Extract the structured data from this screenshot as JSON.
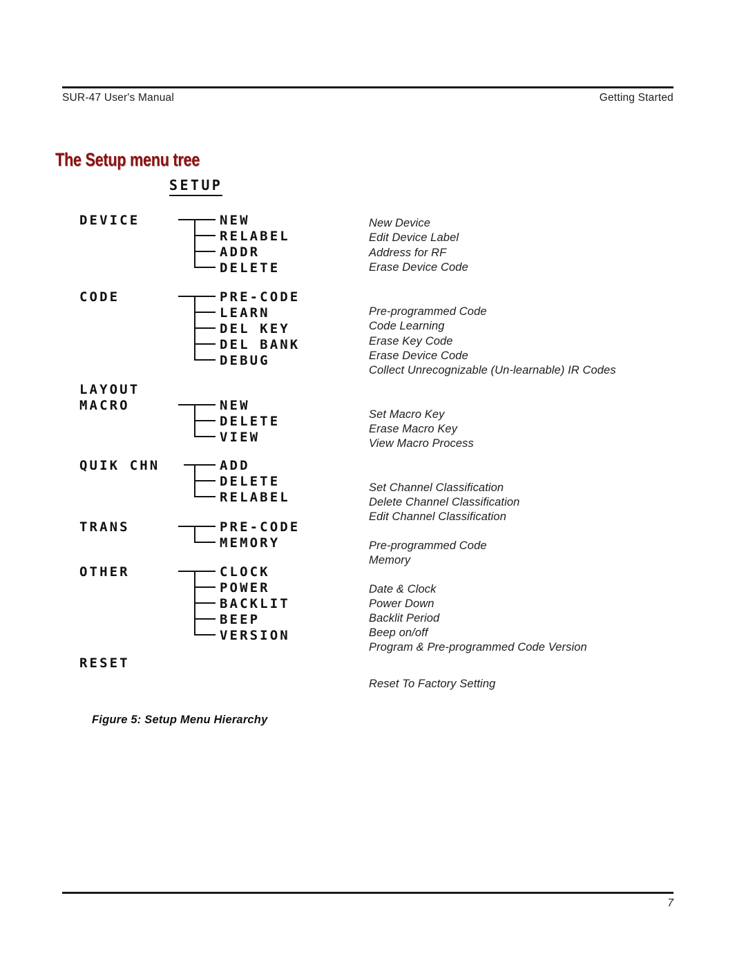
{
  "header": {
    "left": "SUR-47 User's Manual",
    "right": "Getting Started"
  },
  "section": {
    "title": "The Setup menu tree",
    "title_color": "#8C1111"
  },
  "figure": {
    "root_label": "SETUP",
    "caption": "Figure 5:  Setup Menu Hierarchy",
    "groups": [
      {
        "parent": "DEVICE",
        "children": [
          "NEW",
          "RELABEL",
          "ADDR",
          "DELETE"
        ],
        "descriptions": [
          "New Device",
          "Edit Device Label",
          "Address for RF",
          "Erase Device Code"
        ]
      },
      {
        "parent": "CODE",
        "children": [
          "PRE-CODE",
          "LEARN",
          "DEL KEY",
          "DEL BANK",
          "DEBUG"
        ],
        "descriptions": [
          "Pre-programmed Code",
          "Code Learning",
          "Erase Key Code",
          "Erase Device Code",
          "Collect Unrecognizable (Un-learnable) IR Codes"
        ]
      },
      {
        "parent": "LAYOUT",
        "children": [],
        "descriptions": []
      },
      {
        "parent": "MACRO",
        "children": [
          "NEW",
          "DELETE",
          "VIEW"
        ],
        "descriptions": [
          "Set Macro Key",
          "Erase Macro Key",
          "View Macro Process"
        ]
      },
      {
        "parent": "QUIK CHN",
        "children": [
          "ADD",
          "DELETE",
          "RELABEL"
        ],
        "descriptions": [
          "Set Channel Classification",
          "Delete Channel Classification",
          "Edit Channel Classification"
        ]
      },
      {
        "parent": "TRANS",
        "children": [
          "PRE-CODE",
          "MEMORY"
        ],
        "descriptions": [
          "Pre-programmed Code",
          "Memory"
        ]
      },
      {
        "parent": "OTHER",
        "children": [
          "CLOCK",
          "POWER",
          "BACKLIT",
          "BEEP",
          "VERSION"
        ],
        "descriptions": [
          "Date & Clock",
          "Power Down",
          "Backlit Period",
          "Beep on/off",
          "Program & Pre-programmed Code Version"
        ]
      },
      {
        "parent": "RESET",
        "children": [],
        "descriptions": [
          "Reset To Factory Setting"
        ]
      }
    ]
  },
  "footer": {
    "page_number": "7"
  }
}
